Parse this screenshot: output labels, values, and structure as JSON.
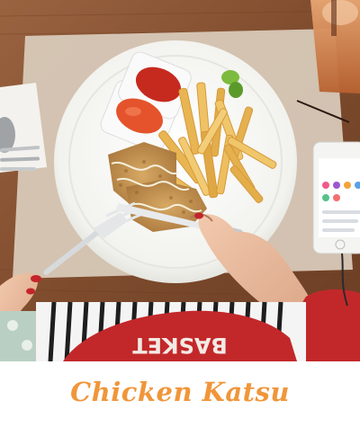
{
  "caption": {
    "text": "Chicken Katsu",
    "color": "#f0963a"
  },
  "photo": {
    "jersey_text": "BASKET",
    "palette": {
      "table": "#8a5433",
      "placemat": "#d8c9b8",
      "plate": "#f7f7f4",
      "fries": "#e8b552",
      "katsu": "#c69652",
      "ketchup": "#c62a1f",
      "sauce": "#e4532b",
      "jersey": "#c2282a",
      "phone": "#f4f4f2"
    }
  }
}
